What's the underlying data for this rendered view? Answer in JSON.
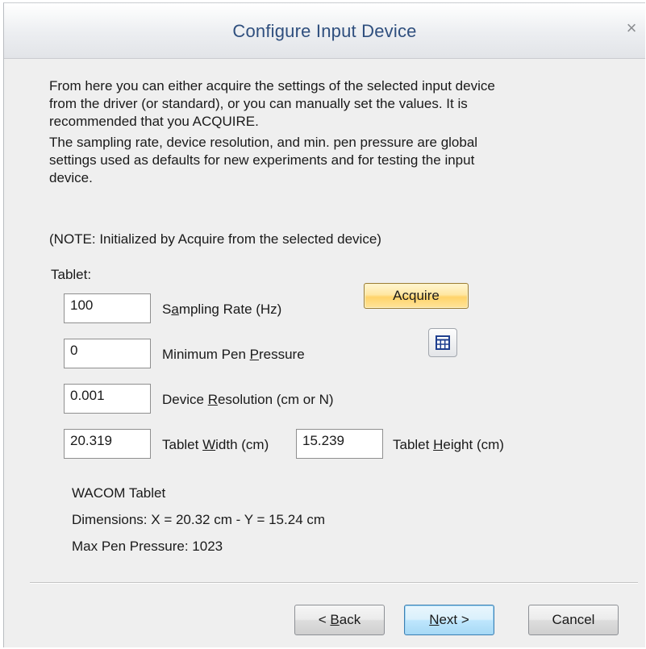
{
  "window": {
    "title": "Configure Input Device",
    "close_glyph": "×"
  },
  "intro": {
    "paragraph1": "From here you can either acquire the settings of the selected input device from the driver (or standard), or you can manually set the values. It is recommended that you ACQUIRE.",
    "paragraph2": "The sampling rate, device resolution, and min. pen pressure are global settings used as defaults for new experiments and for testing the input device.",
    "note": "(NOTE: Initialized by Acquire from the selected device)"
  },
  "tablet": {
    "section_label": "Tablet:",
    "sampling_rate": {
      "value": "100",
      "label_pre": "S",
      "label_key": "a",
      "label_post": "mpling Rate (Hz)"
    },
    "min_pen_pressure": {
      "value": "0",
      "label_pre": "Minimum Pen ",
      "label_key": "P",
      "label_post": "ressure"
    },
    "device_resolution": {
      "value": "0.001",
      "label_pre": "Device ",
      "label_key": "R",
      "label_post": "esolution (cm or N)"
    },
    "tablet_width": {
      "value": "20.319",
      "label_pre": "Tablet ",
      "label_key": "W",
      "label_post": "idth (cm)"
    },
    "tablet_height": {
      "value": "15.239",
      "label_pre": "Tablet ",
      "label_key": "H",
      "label_post": "eight (cm)"
    },
    "acquire_label": "Acquire",
    "calculator_icon": "calculator-icon"
  },
  "device_info": {
    "name": "WACOM Tablet",
    "dimensions": "Dimensions: X = 20.32 cm - Y = 15.24 cm",
    "max_pressure": "Max Pen Pressure: 1023"
  },
  "footer": {
    "back": {
      "pre": "< ",
      "key": "B",
      "post": "ack"
    },
    "next": {
      "pre": "",
      "key": "N",
      "post": "ext >"
    },
    "cancel": "Cancel"
  }
}
